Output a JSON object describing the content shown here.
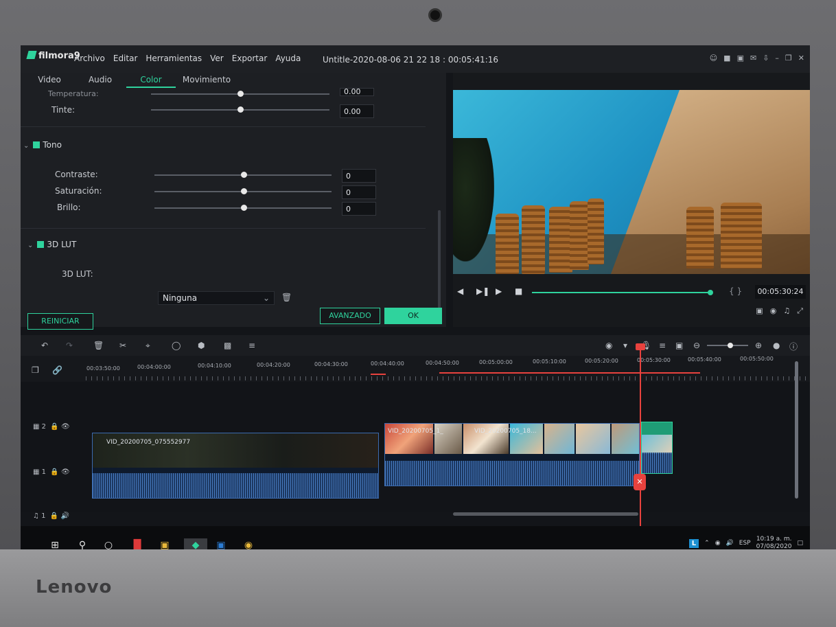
{
  "app": {
    "logo": "filmora9",
    "menu": [
      "Archivo",
      "Editar",
      "Herramientas",
      "Ver",
      "Exportar",
      "Ayuda"
    ],
    "document_title": "Untitle-2020-08-06 21 22 18 : 00:05:41:16"
  },
  "editor": {
    "tabs": [
      "Video",
      "Audio",
      "Color",
      "Movimiento"
    ],
    "active_tab": "Color",
    "rows": {
      "temperatura": {
        "label": "Temperatura:",
        "value": "0.00"
      },
      "tinte": {
        "label": "Tinte:",
        "value": "0.00"
      },
      "contraste": {
        "label": "Contraste:",
        "value": "0"
      },
      "saturacion": {
        "label": "Saturación:",
        "value": "0"
      },
      "brillo": {
        "label": "Brillo:",
        "value": "0"
      }
    },
    "sections": {
      "tono": "Tono",
      "lut": "3D LUT"
    },
    "lut": {
      "label": "3D LUT:",
      "selected": "Ninguna"
    },
    "buttons": {
      "reset": "REINICIAR",
      "advanced": "AVANZADO",
      "ok": "OK"
    }
  },
  "preview": {
    "timecode": "00:05:30:24",
    "progress": 0.97
  },
  "ruler": {
    "labels": [
      "00:03:50:00",
      "00:04:00:00",
      "00:04:10:00",
      "00:04:20:00",
      "00:04:30:00",
      "00:04:40:00",
      "00:04:50:00",
      "00:05:00:00",
      "00:05:10:00",
      "00:05:20:00",
      "00:05:30:00",
      "00:05:40:00",
      "00:05:50:00"
    ]
  },
  "tracks": {
    "video2": "2",
    "video1": "1",
    "audio1": "1"
  },
  "clips": {
    "main": "VID_20200705_075552977",
    "second": "VID_20200705_1_",
    "third": "VID_20200705_18..."
  },
  "taskbar": {
    "language": "ESP",
    "time": "10:19 a. m.",
    "date": "07/08/2020",
    "tray_letter": "L"
  },
  "device": {
    "brand": "Lenovo"
  }
}
